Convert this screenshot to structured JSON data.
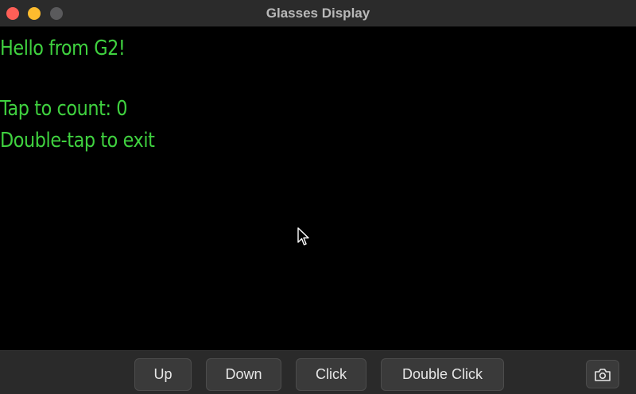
{
  "window": {
    "title": "Glasses Display"
  },
  "display": {
    "lines": [
      "Hello from G2!",
      "Tap to count: 0",
      "Double-tap to exit"
    ],
    "text_color": "#3fd13f",
    "background": "#000000"
  },
  "toolbar": {
    "up_label": "Up",
    "down_label": "Down",
    "click_label": "Click",
    "double_click_label": "Double Click",
    "camera_icon": "camera-icon"
  },
  "colors": {
    "close": "#ff5f57",
    "minimize": "#febc2e",
    "maximize_inactive": "#5a5a5c"
  }
}
